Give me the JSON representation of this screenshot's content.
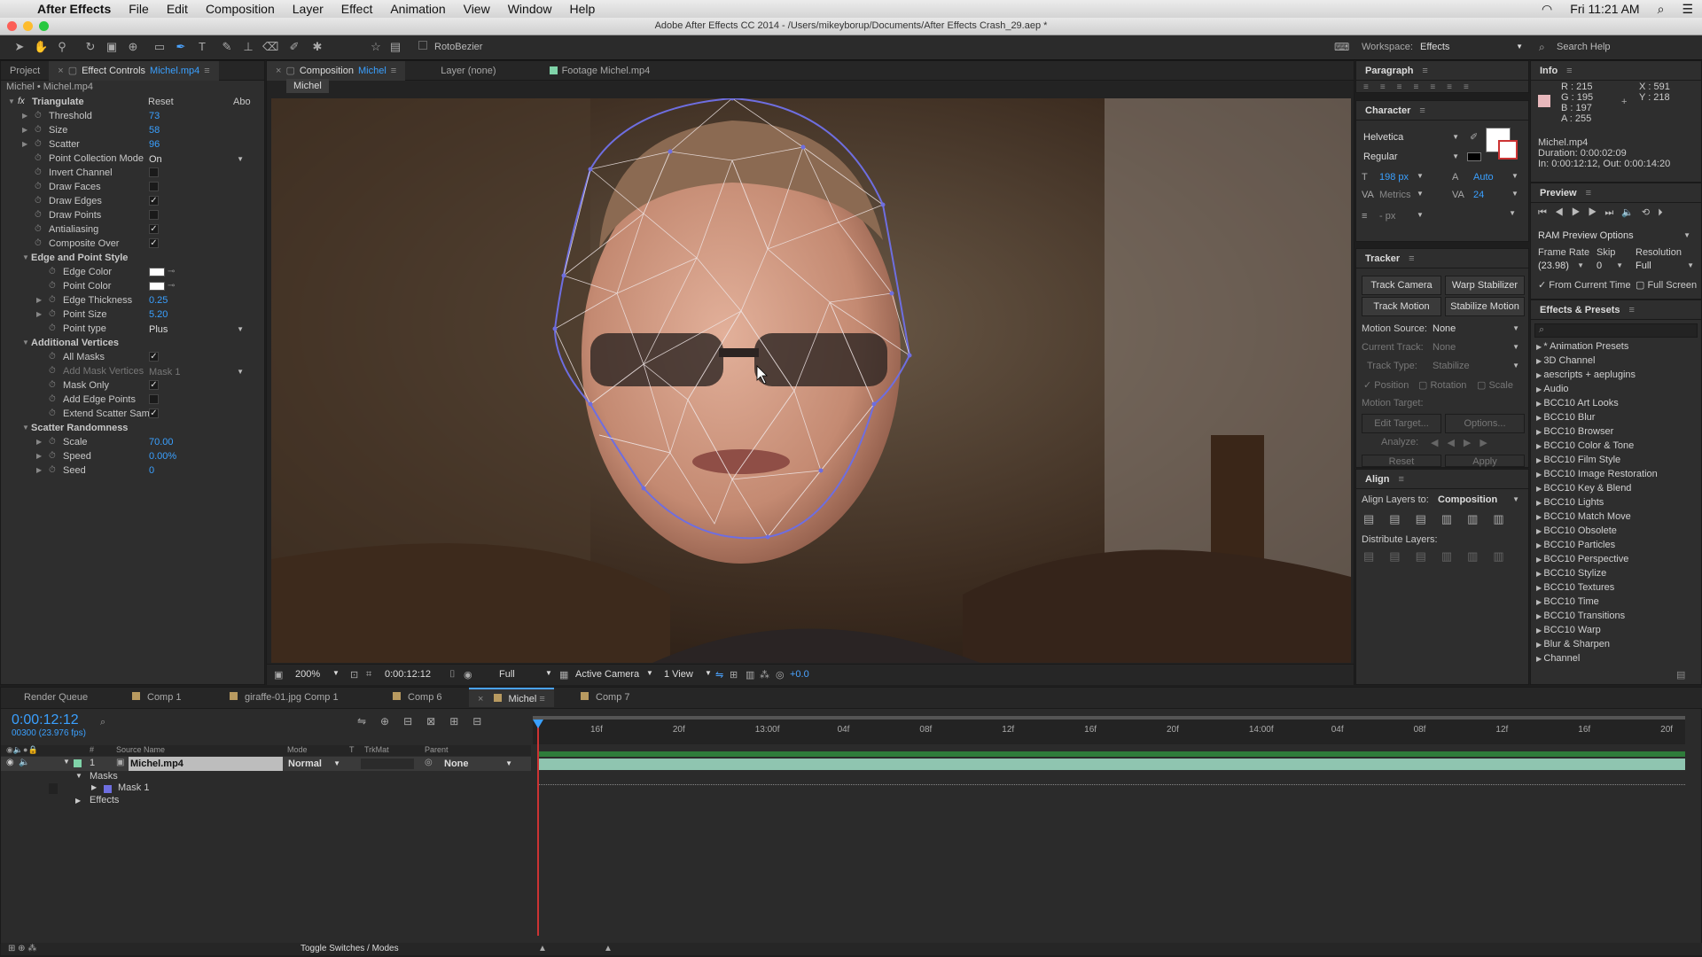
{
  "menubar": {
    "app": "After Effects",
    "items": [
      "File",
      "Edit",
      "Composition",
      "Layer",
      "Effect",
      "Animation",
      "View",
      "Window",
      "Help"
    ],
    "clock": "Fri 11:21 AM"
  },
  "window": {
    "title": "Adobe After Effects CC 2014 - /Users/mikeyborup/Documents/After Effects Crash_29.aep *"
  },
  "toolbar": {
    "rotobezier": "RotoBezier",
    "workspace_label": "Workspace:",
    "workspace_value": "Effects",
    "search_help": "Search Help"
  },
  "project_panel": {
    "tab_project": "Project",
    "tab_effect_controls": "Effect Controls",
    "tab_effect_controls_file": "Michel.mp4",
    "breadcrumb": "Michel • Michel.mp4",
    "effect_name": "Triangulate",
    "reset": "Reset",
    "about": "Abo",
    "rows": [
      {
        "label": "Threshold",
        "value": "73"
      },
      {
        "label": "Size",
        "value": "58"
      },
      {
        "label": "Scatter",
        "value": "96"
      },
      {
        "label": "Point Collection Mode",
        "value": "On"
      },
      {
        "label": "Invert Channel"
      },
      {
        "label": "Draw Faces"
      },
      {
        "label": "Draw Edges",
        "check": "✓"
      },
      {
        "label": "Draw Points"
      },
      {
        "label": "Antialiasing",
        "check": "✓"
      },
      {
        "label": "Composite Over",
        "check": "✓"
      },
      {
        "label": "Edge and Point Style"
      },
      {
        "label": "Edge Color"
      },
      {
        "label": "Point Color"
      },
      {
        "label": "Edge Thickness",
        "value": "0.25"
      },
      {
        "label": "Point Size",
        "value": "5.20"
      },
      {
        "label": "Point type",
        "value": "Plus"
      },
      {
        "label": "Additional Vertices"
      },
      {
        "label": "All Masks",
        "check": "✓"
      },
      {
        "label": "Add Mask Vertices",
        "value": "Mask 1"
      },
      {
        "label": "Mask Only",
        "check": "✓"
      },
      {
        "label": "Add Edge Points"
      },
      {
        "label": "Extend Scatter Sam",
        "check": "✓"
      },
      {
        "label": "Scatter Randomness"
      },
      {
        "label": "Scale",
        "value": "70.00"
      },
      {
        "label": "Speed",
        "value": "0.00%"
      },
      {
        "label": "Seed",
        "value": "0"
      }
    ]
  },
  "comp_panel": {
    "tab_composition": "Composition",
    "tab_composition_name": "Michel",
    "tab_layer": "Layer (none)",
    "tab_footage": "Footage Michel.mp4",
    "comp_badge": "Michel",
    "zoom": "200%",
    "timecode": "0:00:12:12",
    "resolution": "Full",
    "camera": "Active Camera",
    "views": "1 View",
    "exposure": "+0.0"
  },
  "paragraph_panel": {
    "title": "Paragraph"
  },
  "character_panel": {
    "title": "Character",
    "font": "Helvetica",
    "style": "Regular",
    "size": "198 px",
    "leading": "Auto",
    "kerning": "Metrics",
    "tracking": "24",
    "stroke": "- px"
  },
  "tracker_panel": {
    "title": "Tracker",
    "track_camera": "Track Camera",
    "warp_stabilizer": "Warp Stabilizer",
    "track_motion": "Track Motion",
    "stabilize_motion": "Stabilize Motion",
    "motion_source_label": "Motion Source:",
    "motion_source": "None",
    "current_track_label": "Current Track:",
    "current_track": "None",
    "track_type_label": "Track Type:",
    "track_type": "Stabilize",
    "position": "Position",
    "rotation": "Rotation",
    "scale": "Scale",
    "motion_target": "Motion Target:",
    "edit_target": "Edit Target...",
    "options": "Options...",
    "analyze": "Analyze:",
    "reset": "Reset",
    "apply": "Apply"
  },
  "align_panel": {
    "title": "Align",
    "align_to_label": "Align Layers to:",
    "align_to": "Composition",
    "distribute": "Distribute Layers:"
  },
  "info_panel": {
    "title": "Info",
    "r": "R : 215",
    "g": "G : 195",
    "b": "B : 197",
    "a": "A : 255",
    "x": "X : 591",
    "y": "Y : 218",
    "file": "Michel.mp4",
    "duration": "Duration: 0:00:02:09",
    "inout": "In: 0:00:12:12, Out: 0:00:14:20",
    "color": "#e8b8bc"
  },
  "preview_panel": {
    "title": "Preview",
    "ram": "RAM Preview Options",
    "frame_rate_label": "Frame Rate",
    "skip_label": "Skip",
    "resolution_label": "Resolution",
    "frame_rate": "(23.98)",
    "skip": "0",
    "resolution": "Full",
    "from_current": "From Current Time",
    "full_screen": "Full Screen"
  },
  "effects_presets": {
    "title": "Effects & Presets",
    "items": [
      "* Animation Presets",
      "3D Channel",
      "aescripts + aeplugins",
      "Audio",
      "BCC10 Art Looks",
      "BCC10 Blur",
      "BCC10 Browser",
      "BCC10 Color & Tone",
      "BCC10 Film Style",
      "BCC10 Image Restoration",
      "BCC10 Key & Blend",
      "BCC10 Lights",
      "BCC10 Match Move",
      "BCC10 Obsolete",
      "BCC10 Particles",
      "BCC10 Perspective",
      "BCC10 Stylize",
      "BCC10 Textures",
      "BCC10 Time",
      "BCC10 Transitions",
      "BCC10 Warp",
      "Blur & Sharpen",
      "Channel"
    ]
  },
  "timeline": {
    "tabs": [
      "Render Queue",
      "Comp 1",
      "giraffe-01.jpg Comp 1",
      "Comp 6",
      "Michel",
      "Comp 7"
    ],
    "timecode": "0:00:12:12",
    "frame": "00300 (23.976 fps)",
    "col_source": "Source Name",
    "col_mode": "Mode",
    "col_t": "T",
    "col_trkmat": "TrkMat",
    "col_parent": "Parent",
    "layer_num": "1",
    "layer_name": "Michel.mp4",
    "layer_mode": "Normal",
    "layer_parent": "None",
    "masks": "Masks",
    "mask1": "Mask 1",
    "effects": "Effects",
    "ruler": [
      "16f",
      "20f",
      "13:00f",
      "04f",
      "08f",
      "12f",
      "16f",
      "20f",
      "14:00f",
      "04f",
      "08f",
      "12f",
      "16f",
      "20f"
    ],
    "toggle": "Toggle Switches / Modes"
  }
}
